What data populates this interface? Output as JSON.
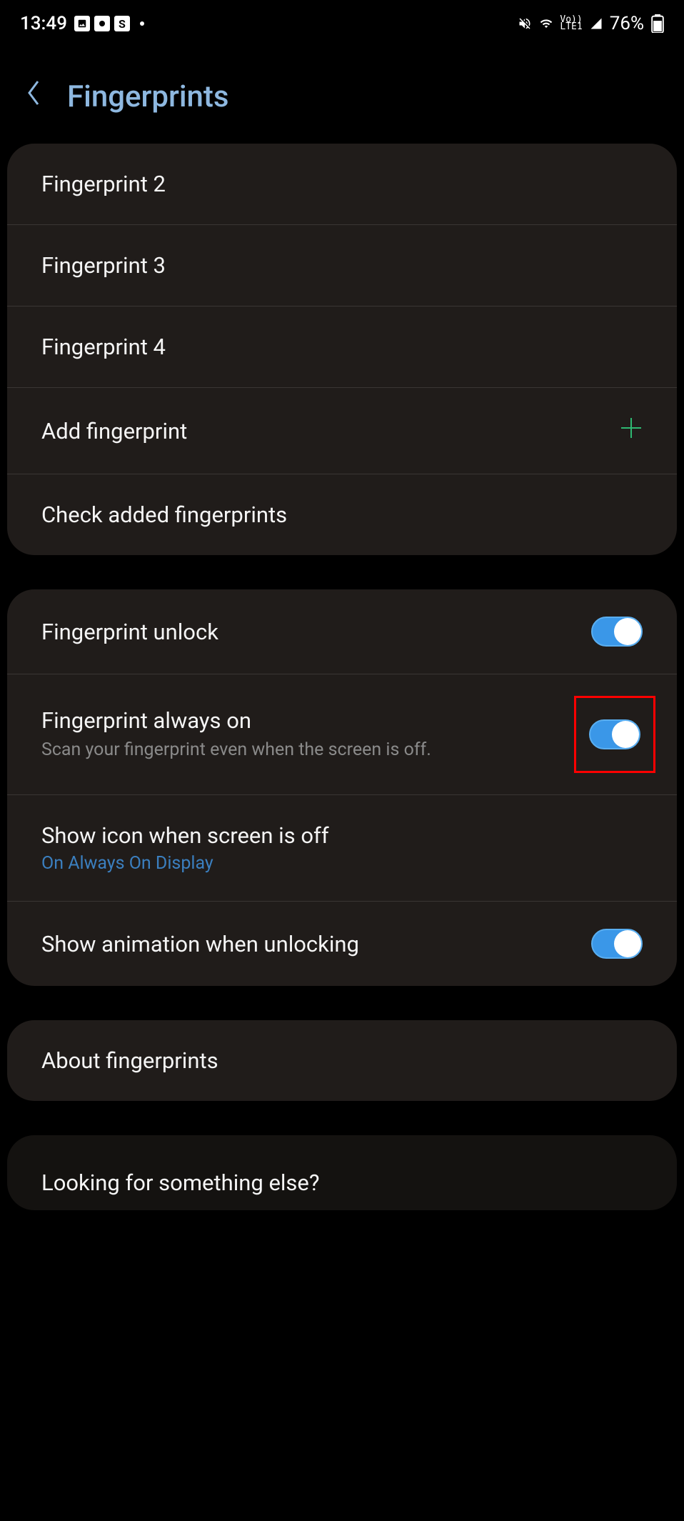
{
  "status": {
    "time": "13:49",
    "battery": "76%",
    "lte_label": "Vo))\nLTE1"
  },
  "header": {
    "title": "Fingerprints"
  },
  "fingerprints": {
    "items": [
      {
        "label": "Fingerprint 2"
      },
      {
        "label": "Fingerprint 3"
      },
      {
        "label": "Fingerprint 4"
      }
    ],
    "add_label": "Add fingerprint",
    "check_label": "Check added fingerprints"
  },
  "settings": {
    "unlock": {
      "label": "Fingerprint unlock",
      "value": true
    },
    "always_on": {
      "label": "Fingerprint always on",
      "subtitle": "Scan your fingerprint even when the screen is off.",
      "value": true
    },
    "show_icon": {
      "label": "Show icon when screen is off",
      "subtitle": "On Always On Display"
    },
    "show_animation": {
      "label": "Show animation when unlocking",
      "value": true
    }
  },
  "about": {
    "label": "About fingerprints"
  },
  "footer": {
    "text": "Looking for something else?"
  }
}
